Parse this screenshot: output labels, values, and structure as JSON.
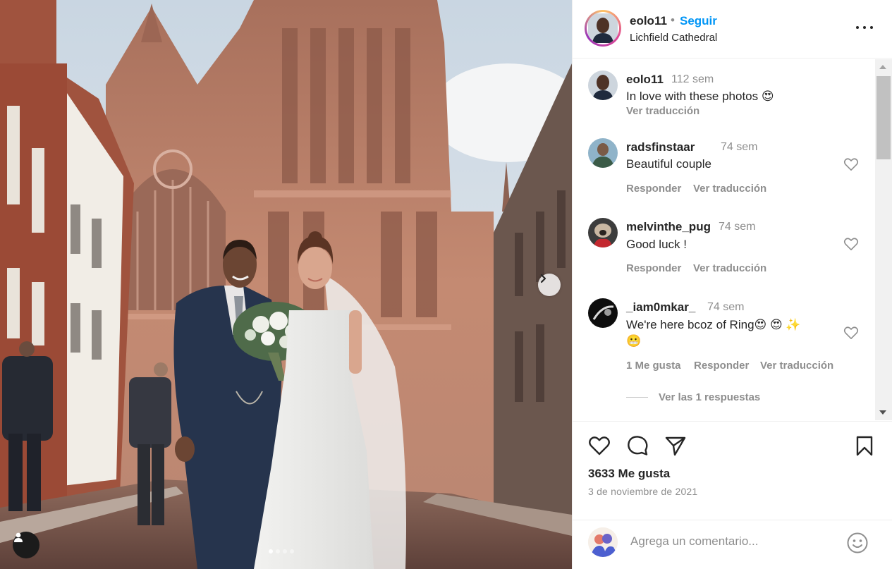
{
  "header": {
    "username": "eolo11",
    "separator": "•",
    "follow_label": "Seguir",
    "location": "Lichfield Cathedral",
    "more_icon": "more-horizontal-icon"
  },
  "comments": [
    {
      "username": "eolo11",
      "time": "112 sem",
      "text": "In love with these photos 😍",
      "translate": "Ver traducción"
    },
    {
      "username": "radsfinstaar",
      "time": "74 sem",
      "text": "Beautiful couple",
      "reply": "Responder",
      "translate": "Ver traducción"
    },
    {
      "username": "melvinthe_pug",
      "time": "74 sem",
      "text": "Good luck !",
      "reply": "Responder",
      "translate": "Ver traducción"
    },
    {
      "username": "_iam0mkar_",
      "time": "74 sem",
      "text_line1": "We're here bcoz of Ring😍 😍 ✨",
      "text_line2": "😬",
      "likes": "1 Me gusta",
      "reply": "Responder",
      "translate": "Ver traducción",
      "view_replies": "Ver las 1 respuestas"
    }
  ],
  "actions": {
    "likes": "3633 Me gusta",
    "date": "3 de noviembre de 2021"
  },
  "add_comment": {
    "placeholder": "Agrega un comentario..."
  },
  "carousel": {
    "slide_count": 4,
    "active_index": 0
  },
  "colors": {
    "accent": "#0095f6",
    "text": "#262626",
    "secondary": "#8e8e8e"
  }
}
